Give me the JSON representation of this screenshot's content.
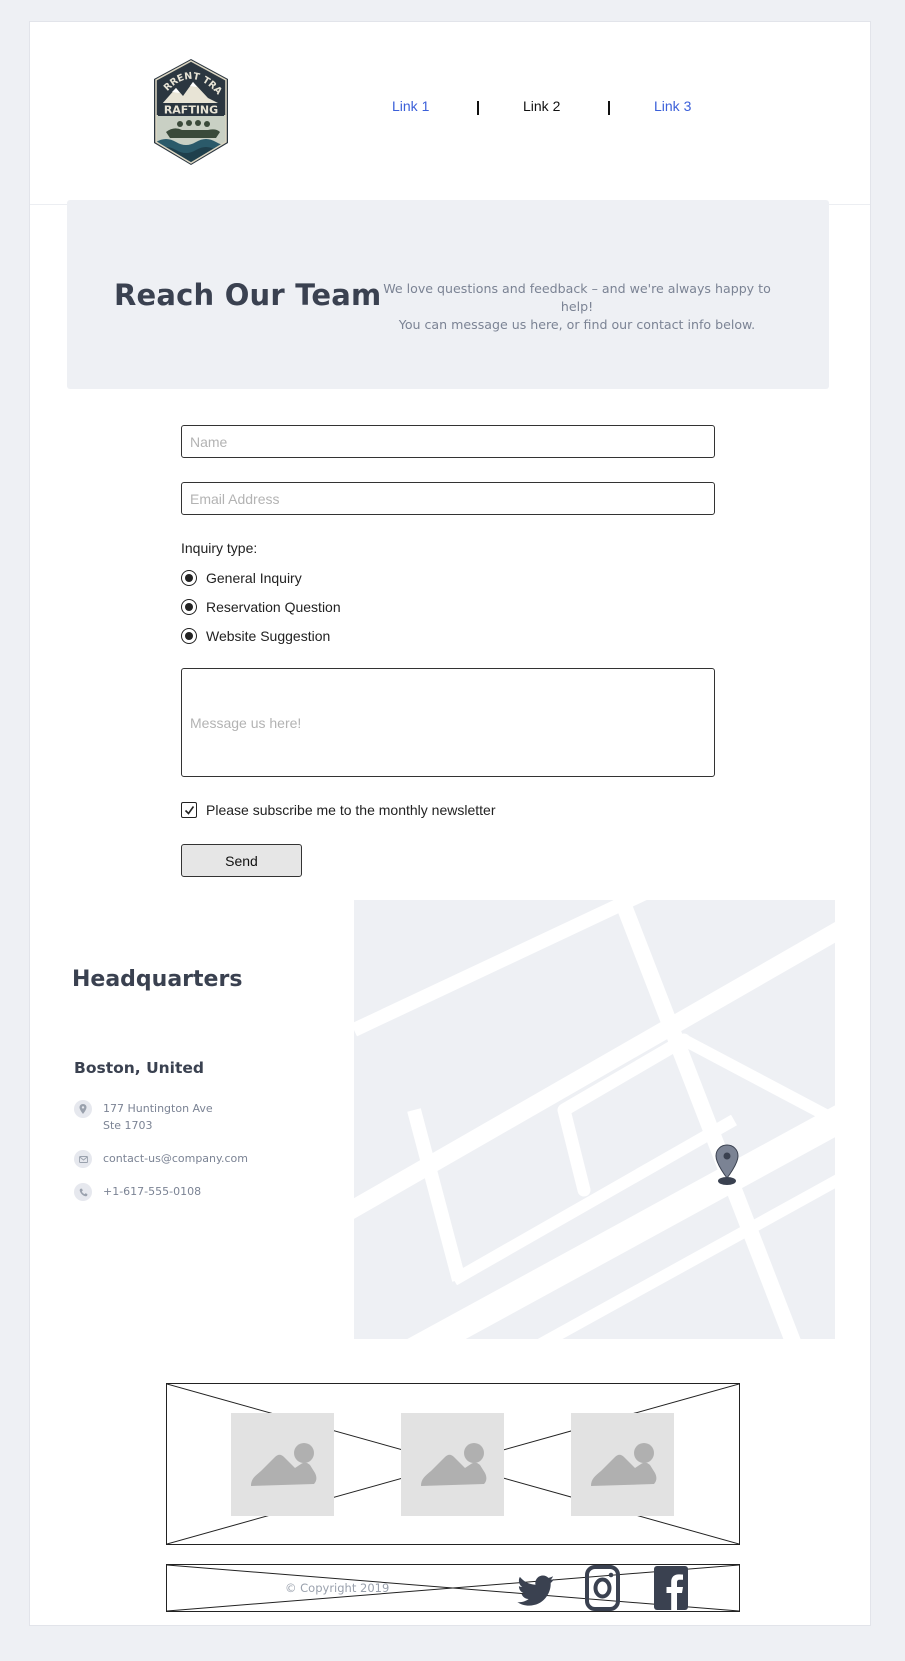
{
  "header": {
    "logo": {
      "arc_text": "TORRENT TRAIL",
      "banner_text": "RAFTING",
      "icon": "rafting-logo"
    },
    "nav": [
      {
        "label": "Link 1",
        "color": "#3b5fd9"
      },
      {
        "label": "Link 2",
        "color": "#111111"
      },
      {
        "label": "Link 3",
        "color": "#3b5fd9"
      }
    ]
  },
  "hero": {
    "title": "Reach Our Team",
    "text_line1": "We love questions and feedback – and we're always happy to help!",
    "text_line2": "You can message us here, or find our contact info below."
  },
  "form": {
    "name_placeholder": "Name",
    "email_placeholder": "Email Address",
    "inquiry_label": "Inquiry type:",
    "inquiry_options": [
      "General Inquiry",
      "Reservation Question",
      "Website Suggestion"
    ],
    "message_placeholder": "Message us here!",
    "newsletter_label": "Please subscribe me to the monthly newsletter",
    "newsletter_checked": true,
    "send_label": "Send"
  },
  "headquarters": {
    "title": "Headquarters",
    "city": "Boston, United",
    "address_line1": "177 Huntington Ave",
    "address_line2": "Ste 1703",
    "email": "contact-us@company.com",
    "phone": "+1-617-555-0108",
    "icons": [
      "location-icon",
      "mail-icon",
      "phone-icon"
    ]
  },
  "map": {
    "icon": "map-pin-icon",
    "background_color": "#eef0f4",
    "road_color": "#ffffff",
    "pin_color": "#7b8394"
  },
  "gallery": {
    "image_icons": [
      "image-placeholder-icon",
      "image-placeholder-icon",
      "image-placeholder-icon"
    ]
  },
  "footer": {
    "copyright": "© Copyright 2019",
    "social_icons": [
      "twitter-icon",
      "instagram-icon",
      "facebook-icon"
    ],
    "social_color": "#3a4150"
  },
  "colors": {
    "page_background": "#eef0f4",
    "heading": "#3a4150",
    "muted_text": "#7b8394",
    "link": "#3b5fd9"
  }
}
